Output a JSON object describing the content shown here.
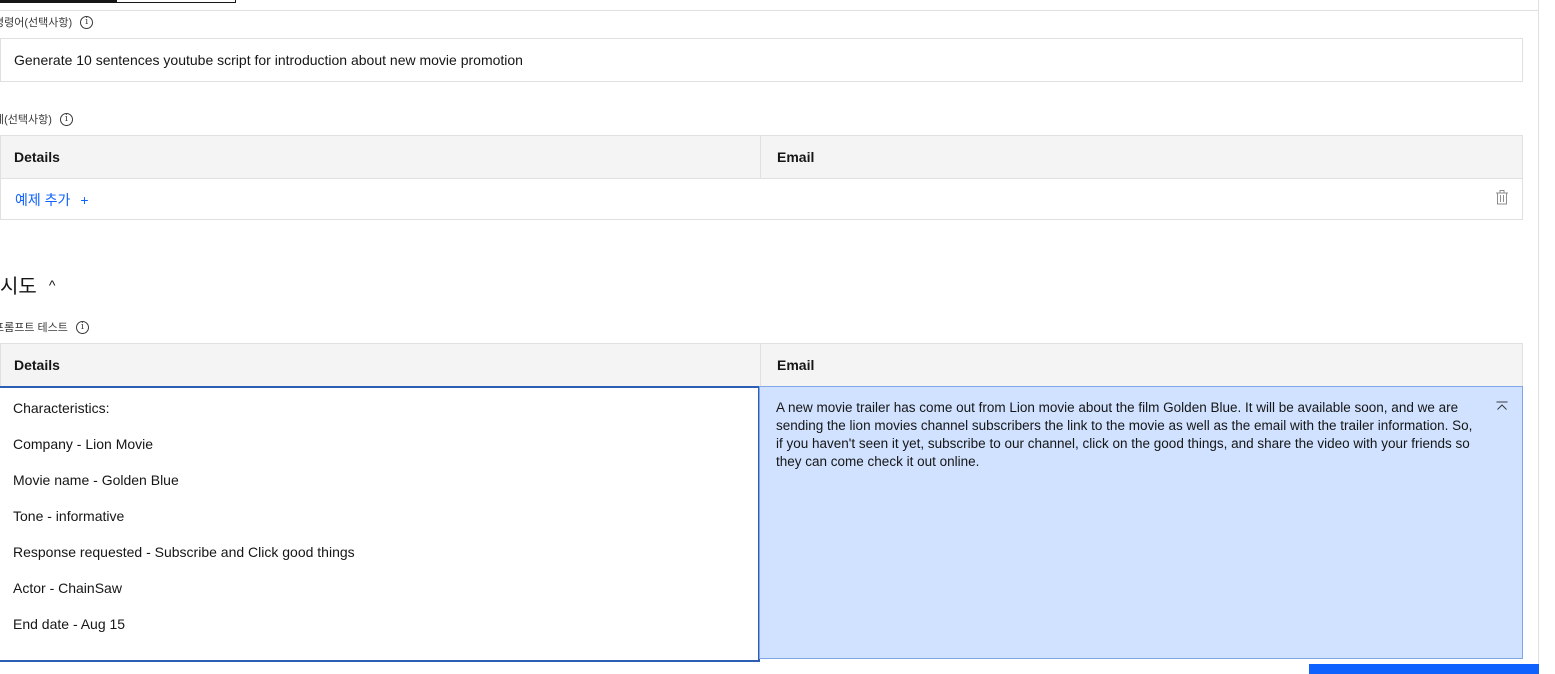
{
  "instruction": {
    "label": "명령어(선택사항)",
    "value": "Generate 10 sentences youtube script for introduction about new movie promotion"
  },
  "examples": {
    "label": "예(선택사항)",
    "columns": [
      "Details",
      "Email"
    ],
    "add_label": "예제 추가",
    "add_symbol": "+"
  },
  "attempt": {
    "title": "시도",
    "test_label": "프롬프트 테스트",
    "columns": [
      "Details",
      "Email"
    ],
    "input_lines": [
      "Characteristics:",
      "Company - Lion Movie",
      "Movie name - Golden Blue",
      "Tone - informative",
      "Response requested - Subscribe and Click good things",
      "Actor - ChainSaw",
      "End date - Aug 15"
    ],
    "output": "A new movie trailer has come out from Lion movie about the film Golden Blue. It will be available soon, and we are sending the lion movies channel subscribers the link to the movie as well as the email with the trailer information. So, if you haven't seen it yet, subscribe to our channel, click on the good things, and share the video with your friends so they can come check it out online."
  },
  "icons": {
    "info": "i",
    "chevron_up": "^"
  },
  "colors": {
    "accent": "#0f62fe",
    "output_bg": "#d0e2ff",
    "header_bg": "#f4f4f4"
  }
}
